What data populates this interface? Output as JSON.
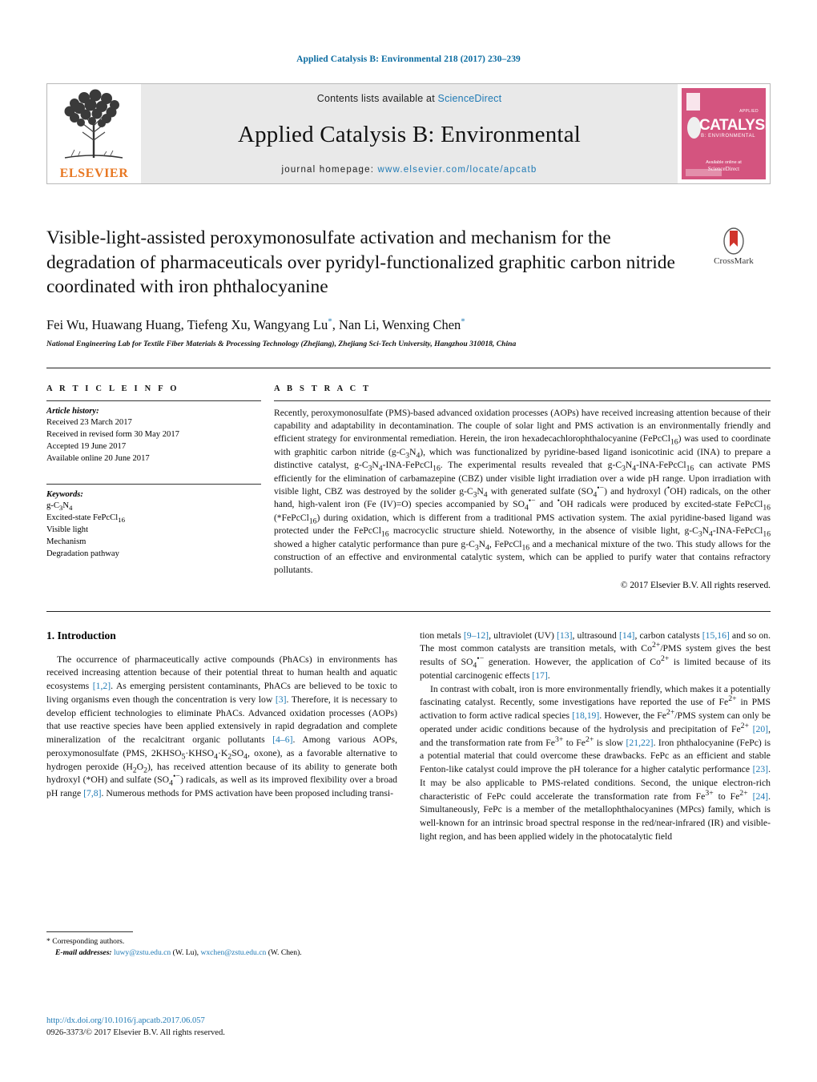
{
  "running_head": "Applied Catalysis B: Environmental 218 (2017) 230–239",
  "masthead": {
    "publisher_name": "ELSEVIER",
    "contents_prefix": "Contents lists available at ",
    "contents_link": "ScienceDirect",
    "journal_title": "Applied Catalysis B: Environmental",
    "homepage_label": "journal homepage: ",
    "homepage_url": "www.elsevier.com/locate/apcatb",
    "cover": {
      "applied_label": "APPLIED",
      "main_word": "CATALYSIS",
      "sub_word": "B: ENVIRONMENTAL",
      "bottom_note": "Available online at",
      "provider": "ScienceDirect",
      "accent_color": "#d4547f"
    }
  },
  "article": {
    "title": "Visible-light-assisted peroxymonosulfate activation and mechanism for the degradation of pharmaceuticals over pyridyl-functionalized graphitic carbon nitride coordinated with iron phthalocyanine",
    "crossmark_label": "CrossMark",
    "authors": "Fei Wu, Huawang Huang, Tiefeng Xu, Wangyang Lu",
    "authors_tail": ", Nan Li, Wenxing Chen",
    "corresponding_mark": "*",
    "affiliation": "National Engineering Lab for Textile Fiber Materials & Processing Technology (Zhejiang), Zhejiang Sci-Tech University, Hangzhou 310018, China"
  },
  "info": {
    "heading": "A R T I C L E   I N F O",
    "history_title": "Article history:",
    "history": [
      "Received 23 March 2017",
      "Received in revised form 30 May 2017",
      "Accepted 19 June 2017",
      "Available online 20 June 2017"
    ],
    "keywords_title": "Keywords:",
    "keywords": [
      "g-C3N4",
      "Excited-state FePcCl16",
      "Visible light",
      "Mechanism",
      "Degradation pathway"
    ]
  },
  "abstract": {
    "heading": "A B S T R A C T",
    "text": "Recently, peroxymonosulfate (PMS)-based advanced oxidation processes (AOPs) have received increasing attention because of their capability and adaptability in decontamination. The couple of solar light and PMS activation is an environmentally friendly and efficient strategy for environmental remediation. Herein, the iron hexadecachlorophthalocyanine (FePcCl16) was used to coordinate with graphitic carbon nitride (g-C3N4), which was functionalized by pyridine-based ligand isonicotinic acid (INA) to prepare a distinctive catalyst, g-C3N4-INA-FePcCl16. The experimental results revealed that g-C3N4-INA-FePcCl16 can activate PMS efficiently for the elimination of carbamazepine (CBZ) under visible light irradiation over a wide pH range. Upon irradiation with visible light, CBZ was destroyed by the solider g-C3N4 with generated sulfate (SO4•−) and hydroxyl (•OH) radicals, on the other hand, high-valent iron (Fe (IV)=O) species accompanied by SO4•− and •OH radicals were produced by excited-state FePcCl16 (*FePcCl16) during oxidation, which is different from a traditional PMS activation system. The axial pyridine-based ligand was protected under the FePcCl16 macrocyclic structure shield. Noteworthy, in the absence of visible light, g-C3N4-INA-FePcCl16 showed a higher catalytic performance than pure g-C3N4, FePcCl16 and a mechanical mixture of the two. This study allows for the construction of an effective and environmental catalytic system, which can be applied to purify water that contains refractory pollutants.",
    "copyright": "© 2017 Elsevier B.V. All rights reserved."
  },
  "body": {
    "section_number_title": "1.  Introduction",
    "left_paragraph_1": "The occurrence of pharmaceutically active compounds (PhACs) in environments has received increasing attention because of their potential threat to human health and aquatic ecosystems [1,2]. As emerging persistent contaminants, PhACs are believed to be toxic to living organisms even though the concentration is very low [3]. Therefore, it is necessary to develop efficient technologies to eliminate PhACs. Advanced oxidation processes (AOPs) that use reactive species have been applied extensively in rapid degradation and complete mineralization of the recalcitrant organic pollutants [4–6]. Among various AOPs, peroxymonosulfate (PMS, 2KHSO5·KHSO4·K2SO4, oxone), as a favorable alternative to hydrogen peroxide (H2O2), has received attention because of its ability to generate both hydroxyl (•OH) and sulfate (SO4•−) radicals, as well as its improved flexibility over a broad pH range [7,8]. Numerous methods for PMS activation have been proposed including transi-",
    "right_paragraph_1": "tion metals [9–12], ultraviolet (UV) [13], ultrasound [14], carbon catalysts [15,16] and so on. The most common catalysts are transition metals, with Co2+/PMS system gives the best results of SO4•− generation. However, the application of Co2+ is limited because of its potential carcinogenic effects [17].",
    "right_paragraph_2": "In contrast with cobalt, iron is more environmentally friendly, which makes it a potentially fascinating catalyst. Recently, some investigations have reported the use of Fe2+ in PMS activation to form active radical species [18,19]. However, the Fe2+/PMS system can only be operated under acidic conditions because of the hydrolysis and precipitation of Fe2+ [20], and the transformation rate from Fe3+ to Fe2+ is slow [21,22]. Iron phthalocyanine (FePc) is a potential material that could overcome these drawbacks. FePc as an efficient and stable Fenton-like catalyst could improve the pH tolerance for a higher catalytic performance [23]. It may be also applicable to PMS-related conditions. Second, the unique electron-rich characteristic of FePc could accelerate the transformation rate from Fe3+ to Fe2+ [24]. Simultaneously, FePc is a member of the metallophthalocyanines (MPcs) family, which is well-known for an intrinsic broad spectral response in the red/near-infrared (IR) and visible-light region, and has been applied widely in the photocatalytic field"
  },
  "footnote": {
    "corresponding": "Corresponding authors.",
    "email_label": "E-mail addresses:",
    "email_1": "luwy@zstu.edu.cn",
    "email_1_name": "(W. Lu),",
    "email_2": "wxchen@zstu.edu.cn",
    "email_2_name": "(W. Chen)."
  },
  "footer": {
    "doi": "http://dx.doi.org/10.1016/j.apcatb.2017.06.057",
    "issn_line": "0926-3373/© 2017 Elsevier B.V. All rights reserved."
  },
  "colors": {
    "link_blue": "#1f7ab5",
    "header_blue": "#0a6ba0",
    "elsevier_orange": "#e87722",
    "cover_pink": "#d4547f"
  }
}
